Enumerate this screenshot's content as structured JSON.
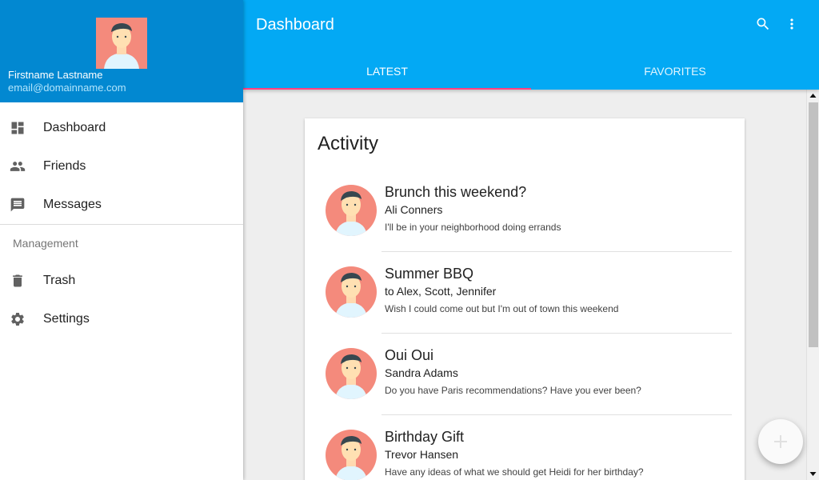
{
  "appbar": {
    "title": "Dashboard",
    "search_icon": "search-icon",
    "more_icon": "more-vert-icon"
  },
  "tabs": [
    {
      "label": "LATEST",
      "active": true
    },
    {
      "label": "FAVORITES",
      "active": false
    }
  ],
  "drawer": {
    "user_name": "Firstname Lastname",
    "user_email": "email@domainname.com",
    "primary_items": [
      {
        "label": "Dashboard",
        "icon": "dashboard-icon"
      },
      {
        "label": "Friends",
        "icon": "people-icon"
      },
      {
        "label": "Messages",
        "icon": "message-icon"
      }
    ],
    "subheader": "Management",
    "secondary_items": [
      {
        "label": "Trash",
        "icon": "trash-icon"
      },
      {
        "label": "Settings",
        "icon": "gear-icon"
      }
    ]
  },
  "card": {
    "title": "Activity",
    "items": [
      {
        "title": "Brunch this weekend?",
        "subtitle": "Ali Conners",
        "body": "I'll be in your neighborhood doing errands"
      },
      {
        "title": "Summer BBQ",
        "subtitle": "to Alex, Scott, Jennifer",
        "body": "Wish I could come out but I'm out of town this weekend"
      },
      {
        "title": "Oui Oui",
        "subtitle": "Sandra Adams",
        "body": "Do you have Paris recommendations? Have you ever been?"
      },
      {
        "title": "Birthday Gift",
        "subtitle": "Trevor Hansen",
        "body": "Have any ideas of what we should get Heidi for her birthday?"
      }
    ]
  },
  "fab": {
    "icon": "plus-icon"
  },
  "colors": {
    "primary": "#03a9f4",
    "primary_dark": "#0288d1",
    "accent": "#ff4081",
    "avatar_bg": "#f48a7c"
  }
}
